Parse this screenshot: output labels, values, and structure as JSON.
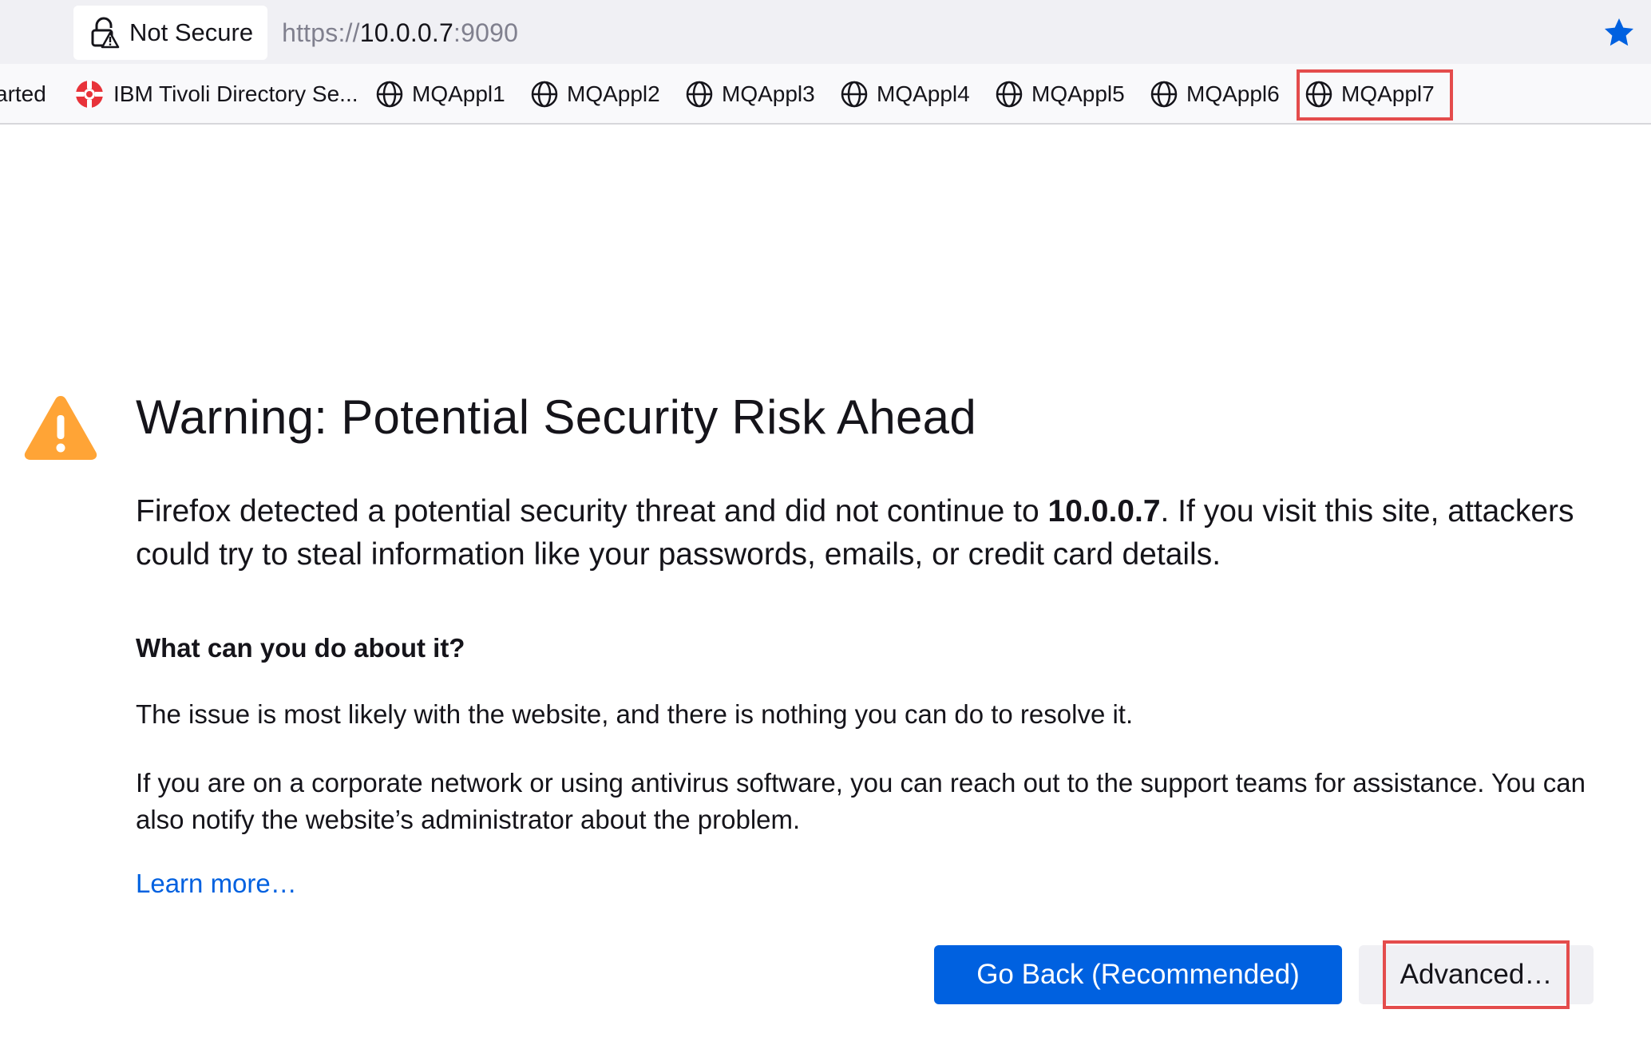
{
  "urlbar": {
    "identity_label": "Not Secure",
    "url_scheme": "https://",
    "url_host": "10.0.0.7",
    "url_port": ":9090"
  },
  "bookmarks": {
    "items": [
      {
        "label": "arted",
        "icon": "none"
      },
      {
        "label": "IBM Tivoli Directory Se...",
        "icon": "ibm-lifebuoy-icon"
      },
      {
        "label": "MQAppl1",
        "icon": "globe-icon"
      },
      {
        "label": "MQAppl2",
        "icon": "globe-icon"
      },
      {
        "label": "MQAppl3",
        "icon": "globe-icon"
      },
      {
        "label": "MQAppl4",
        "icon": "globe-icon"
      },
      {
        "label": "MQAppl5",
        "icon": "globe-icon"
      },
      {
        "label": "MQAppl6",
        "icon": "globe-icon"
      },
      {
        "label": "MQAppl7",
        "icon": "globe-icon"
      }
    ]
  },
  "error_page": {
    "title": "Warning: Potential Security Risk Ahead",
    "intro_before": "Firefox detected a potential security threat and did not continue to ",
    "intro_host": "10.0.0.7",
    "intro_after": ". If you visit this site, attackers could try to steal information like your passwords, emails, or credit card details.",
    "subheading": "What can you do about it?",
    "paragraph_1": "The issue is most likely with the website, and there is nothing you can do to resolve it.",
    "paragraph_2": "If you are on a corporate network or using antivirus software, you can reach out to the support teams for assistance. You can also notify the website’s administrator about the problem.",
    "learn_more": "Learn more…",
    "go_back_button": "Go Back (Recommended)",
    "advanced_button": "Advanced…"
  },
  "colors": {
    "accent_blue": "#0061e0",
    "warning_orange": "#ffa436",
    "highlight_red": "#e44c4c",
    "bookmark_star": "#0061e0"
  }
}
